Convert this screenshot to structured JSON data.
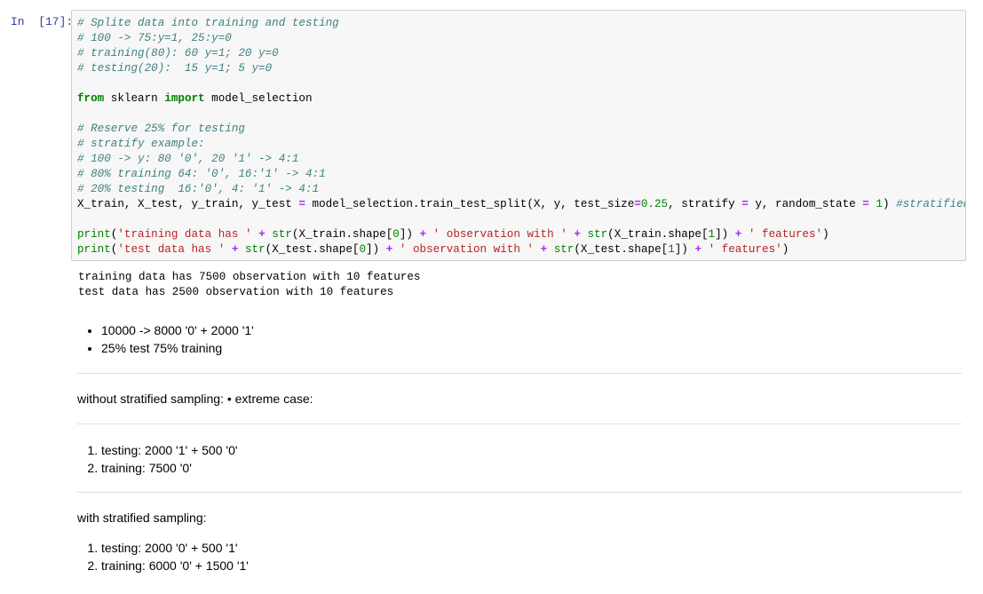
{
  "cell": {
    "prompt": "In  [17]:",
    "code_lines": [
      [
        {
          "t": "c",
          "v": "# Splite data into training and testing"
        }
      ],
      [
        {
          "t": "c",
          "v": "# 100 -> 75:y=1, 25:y=0"
        }
      ],
      [
        {
          "t": "c",
          "v": "# training(80): 60 y=1; 20 y=0"
        }
      ],
      [
        {
          "t": "c",
          "v": "# testing(20):  15 y=1; 5 y=0"
        }
      ],
      [],
      [
        {
          "t": "k",
          "v": "from"
        },
        {
          "t": "t",
          "v": " sklearn "
        },
        {
          "t": "k",
          "v": "import"
        },
        {
          "t": "t",
          "v": " model_selection"
        }
      ],
      [],
      [
        {
          "t": "c",
          "v": "# Reserve 25% for testing"
        }
      ],
      [
        {
          "t": "c",
          "v": "# stratify example:"
        }
      ],
      [
        {
          "t": "c",
          "v": "# 100 -> y: 80 '0', 20 '1' -> 4:1"
        }
      ],
      [
        {
          "t": "c",
          "v": "# 80% training 64: '0', 16:'1' -> 4:1"
        }
      ],
      [
        {
          "t": "c",
          "v": "# 20% testing  16:'0', 4: '1' -> 4:1"
        }
      ],
      [
        {
          "t": "t",
          "v": "X_train, X_test, y_train, y_test "
        },
        {
          "t": "o",
          "v": "="
        },
        {
          "t": "t",
          "v": " model_selection.train_test_split(X, y, test_size"
        },
        {
          "t": "o",
          "v": "="
        },
        {
          "t": "num",
          "v": "0.25"
        },
        {
          "t": "t",
          "v": ", stratify "
        },
        {
          "t": "o",
          "v": "="
        },
        {
          "t": "t",
          "v": " y, random_state "
        },
        {
          "t": "o",
          "v": "="
        },
        {
          "t": "t",
          "v": " "
        },
        {
          "t": "num",
          "v": "1"
        },
        {
          "t": "t",
          "v": ") "
        },
        {
          "t": "c",
          "v": "#stratified sampling"
        }
      ],
      [],
      [
        {
          "t": "bi",
          "v": "print"
        },
        {
          "t": "t",
          "v": "("
        },
        {
          "t": "s",
          "v": "'training data has '"
        },
        {
          "t": "t",
          "v": " "
        },
        {
          "t": "o",
          "v": "+"
        },
        {
          "t": "t",
          "v": " "
        },
        {
          "t": "bi",
          "v": "str"
        },
        {
          "t": "t",
          "v": "(X_train.shape["
        },
        {
          "t": "num",
          "v": "0"
        },
        {
          "t": "t",
          "v": "]) "
        },
        {
          "t": "o",
          "v": "+"
        },
        {
          "t": "t",
          "v": " "
        },
        {
          "t": "s",
          "v": "' observation with '"
        },
        {
          "t": "t",
          "v": " "
        },
        {
          "t": "o",
          "v": "+"
        },
        {
          "t": "t",
          "v": " "
        },
        {
          "t": "bi",
          "v": "str"
        },
        {
          "t": "t",
          "v": "(X_train.shape["
        },
        {
          "t": "num",
          "v": "1"
        },
        {
          "t": "t",
          "v": "]) "
        },
        {
          "t": "o",
          "v": "+"
        },
        {
          "t": "t",
          "v": " "
        },
        {
          "t": "s",
          "v": "' features'"
        },
        {
          "t": "t",
          "v": ")"
        }
      ],
      [
        {
          "t": "bi",
          "v": "print"
        },
        {
          "t": "t",
          "v": "("
        },
        {
          "t": "s",
          "v": "'test data has '"
        },
        {
          "t": "t",
          "v": " "
        },
        {
          "t": "o",
          "v": "+"
        },
        {
          "t": "t",
          "v": " "
        },
        {
          "t": "bi",
          "v": "str"
        },
        {
          "t": "t",
          "v": "(X_test.shape["
        },
        {
          "t": "num",
          "v": "0"
        },
        {
          "t": "t",
          "v": "]) "
        },
        {
          "t": "o",
          "v": "+"
        },
        {
          "t": "t",
          "v": " "
        },
        {
          "t": "s",
          "v": "' observation with '"
        },
        {
          "t": "t",
          "v": " "
        },
        {
          "t": "o",
          "v": "+"
        },
        {
          "t": "t",
          "v": " "
        },
        {
          "t": "bi",
          "v": "str"
        },
        {
          "t": "t",
          "v": "(X_test.shape["
        },
        {
          "t": "num",
          "v": "1"
        },
        {
          "t": "t",
          "v": "]) "
        },
        {
          "t": "o",
          "v": "+"
        },
        {
          "t": "t",
          "v": " "
        },
        {
          "t": "s",
          "v": "' features'"
        },
        {
          "t": "t",
          "v": ")"
        }
      ]
    ],
    "output_lines": [
      "training data has 7500 observation with 10 features",
      "test data has 2500 observation with 10 features"
    ]
  },
  "markdown": {
    "bullets": [
      "10000 -> 8000 '0' + 2000 '1'",
      "25% test 75% training"
    ],
    "without_heading": "without stratified sampling: • extreme case:",
    "without_items": [
      "testing: 2000 '1' + 500 '0'",
      "training: 7500 '0'"
    ],
    "with_heading": "with stratified sampling:",
    "with_items": [
      "testing: 2000 '0' + 500 '1'",
      "training: 6000 '0' + 1500 '1'"
    ]
  },
  "colors": {
    "prompt": "#303f9f",
    "comment": "#408080",
    "keyword": "#008000",
    "string": "#ba2121",
    "operator": "#aa22ff",
    "cell_bg": "#f7f7f7",
    "cell_border": "#cfcfcf"
  }
}
